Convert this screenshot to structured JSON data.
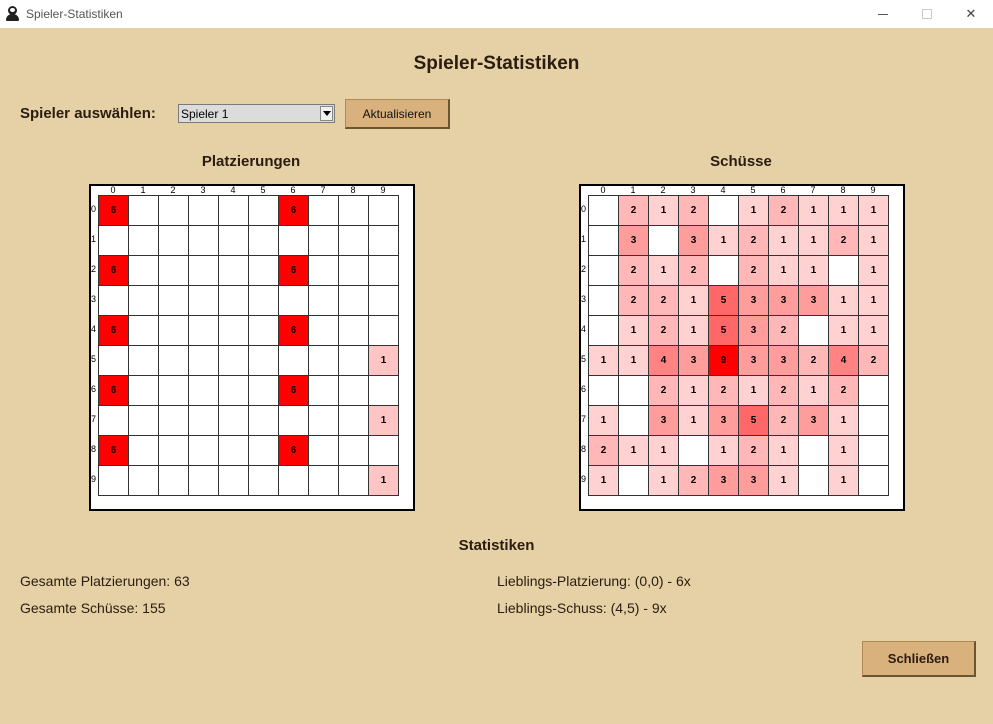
{
  "window": {
    "title": "Spieler-Statistiken"
  },
  "header": {
    "title": "Spieler-Statistiken"
  },
  "controls": {
    "player_label": "Spieler auswählen:",
    "player_selected": "Spieler 1",
    "refresh_label": "Aktualisieren"
  },
  "placements": {
    "title": "Platzierungen",
    "col_labels": [
      "0",
      "1",
      "2",
      "3",
      "4",
      "5",
      "6",
      "7",
      "8",
      "9"
    ],
    "row_labels": [
      "0",
      "1",
      "2",
      "3",
      "4",
      "5",
      "6",
      "7",
      "8",
      "9"
    ],
    "values": [
      [
        6,
        0,
        0,
        0,
        0,
        0,
        6,
        0,
        0,
        0
      ],
      [
        0,
        0,
        0,
        0,
        0,
        0,
        0,
        0,
        0,
        0
      ],
      [
        6,
        0,
        0,
        0,
        0,
        0,
        6,
        0,
        0,
        0
      ],
      [
        0,
        0,
        0,
        0,
        0,
        0,
        0,
        0,
        0,
        0
      ],
      [
        6,
        0,
        0,
        0,
        0,
        0,
        6,
        0,
        0,
        0
      ],
      [
        0,
        0,
        0,
        0,
        0,
        0,
        0,
        0,
        0,
        1
      ],
      [
        6,
        0,
        0,
        0,
        0,
        0,
        6,
        0,
        0,
        0
      ],
      [
        0,
        0,
        0,
        0,
        0,
        0,
        0,
        0,
        0,
        1
      ],
      [
        6,
        0,
        0,
        0,
        0,
        0,
        6,
        0,
        0,
        0
      ],
      [
        0,
        0,
        0,
        0,
        0,
        0,
        0,
        0,
        0,
        1
      ]
    ]
  },
  "shots": {
    "title": "Schüsse",
    "col_labels": [
      "0",
      "1",
      "2",
      "3",
      "4",
      "5",
      "6",
      "7",
      "8",
      "9"
    ],
    "row_labels": [
      "0",
      "1",
      "2",
      "3",
      "4",
      "5",
      "6",
      "7",
      "8",
      "9"
    ],
    "values": [
      [
        0,
        2,
        1,
        2,
        0,
        1,
        2,
        1,
        1,
        1
      ],
      [
        0,
        3,
        0,
        3,
        1,
        2,
        1,
        1,
        2,
        1
      ],
      [
        0,
        2,
        1,
        2,
        0,
        2,
        1,
        1,
        0,
        1
      ],
      [
        0,
        2,
        2,
        1,
        5,
        3,
        3,
        3,
        1,
        1
      ],
      [
        0,
        1,
        2,
        1,
        5,
        3,
        2,
        0,
        1,
        1
      ],
      [
        1,
        1,
        4,
        3,
        9,
        3,
        3,
        2,
        4,
        2
      ],
      [
        0,
        0,
        2,
        1,
        2,
        1,
        2,
        1,
        2,
        0
      ],
      [
        1,
        0,
        3,
        1,
        3,
        5,
        2,
        3,
        1,
        0
      ],
      [
        2,
        1,
        1,
        0,
        1,
        2,
        1,
        0,
        1,
        0
      ],
      [
        1,
        0,
        1,
        2,
        3,
        3,
        1,
        0,
        1,
        0
      ]
    ]
  },
  "stats": {
    "title": "Statistiken",
    "total_placements": "Gesamte Platzierungen: 63",
    "total_shots": "Gesamte Schüsse: 155",
    "favorite_placement": "Lieblings-Platzierung: (0,0) - 6x",
    "favorite_shot": "Lieblings-Schuss: (4,5) - 9x"
  },
  "footer": {
    "close_label": "Schließen"
  },
  "colors": {
    "background": "#e5d1a5",
    "button": "#d9b17c",
    "heat_max": "#ff0000"
  }
}
